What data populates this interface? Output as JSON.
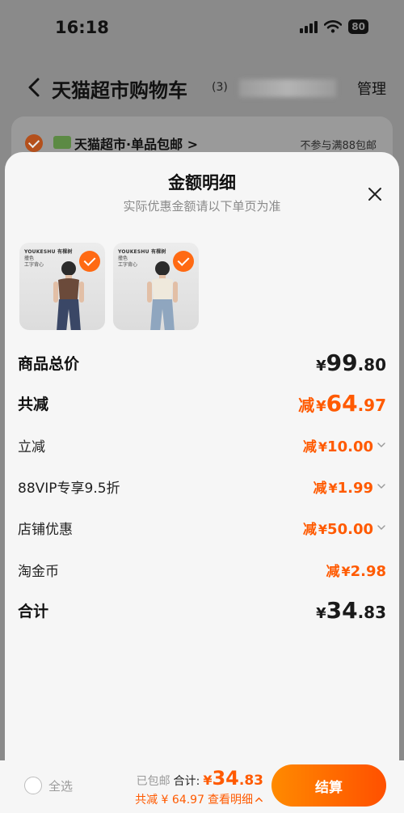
{
  "status_bar": {
    "time": "16:18",
    "battery": "80"
  },
  "header": {
    "title": "天猫超市购物车",
    "count": "(3)",
    "manage_label": "管理"
  },
  "store": {
    "name": "天猫超市·单品包邮 >",
    "note": "不参与满88包邮"
  },
  "sheet": {
    "title": "金额明细",
    "subtitle": "实际优惠金额请以下单页为准",
    "products": [
      {
        "brand": "YOUKESHU 有棵树",
        "tag_line1": "撞色",
        "tag_line2": "工字背心",
        "top_color": "#6b4a3a",
        "bottom_color": "#3a4766"
      },
      {
        "brand": "YOUKESHU 有棵树",
        "tag_line1": "撞色",
        "tag_line2": "工字背心",
        "top_color": "#efe9dc",
        "bottom_color": "#8fa6bf"
      }
    ],
    "rows": [
      {
        "label": "商品总价",
        "prefix": "",
        "yen": "¥",
        "int": "99",
        "dec": ".80",
        "style": "total",
        "chevron": false
      },
      {
        "label": "共减",
        "prefix": "减",
        "yen": "¥",
        "int": "64",
        "dec": ".97",
        "style": "total-discount",
        "chevron": false
      },
      {
        "label": "立减",
        "prefix": "减",
        "yen": "¥",
        "int": "10",
        "dec": ".00",
        "style": "discount",
        "chevron": true
      },
      {
        "label": "88VIP专享9.5折",
        "prefix": "减",
        "yen": "¥",
        "int": "1",
        "dec": ".99",
        "style": "discount",
        "chevron": true
      },
      {
        "label": "店铺优惠",
        "prefix": "减",
        "yen": "¥",
        "int": "50",
        "dec": ".00",
        "style": "discount",
        "chevron": true
      },
      {
        "label": "淘金币",
        "prefix": "减",
        "yen": "¥",
        "int": "2",
        "dec": ".98",
        "style": "discount",
        "chevron": false
      },
      {
        "label": "合计",
        "prefix": "",
        "yen": "¥",
        "int": "34",
        "dec": ".83",
        "style": "total",
        "chevron": false
      }
    ]
  },
  "bottom_bar": {
    "select_all": "全选",
    "free_shipping": "已包邮",
    "total_label": "合计:",
    "total_yen": "¥",
    "total_int": "34",
    "total_dec": ".83",
    "discount_text": "共减 ¥ 64.97",
    "view_detail": "查看明细",
    "checkout": "结算"
  },
  "colors": {
    "accent": "#ff5a00",
    "check": "#ff6a13"
  }
}
